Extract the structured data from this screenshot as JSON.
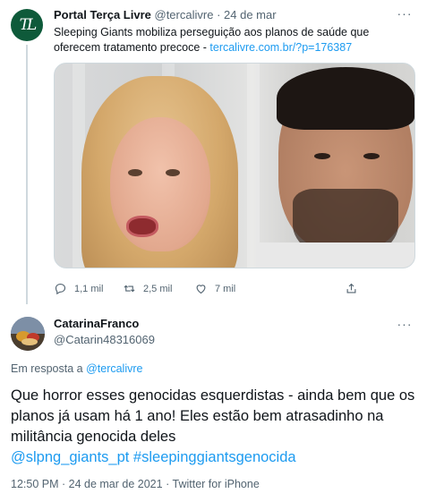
{
  "quoted_tweet": {
    "avatar_text": "TL",
    "author_name": "Portal Terça Livre",
    "author_handle": "@tercalivre",
    "separator": "·",
    "date": "24 de mar",
    "text": "Sleeping Giants mobiliza perseguição aos planos de saúde que oferecem tratamento precoce - ",
    "link": "tercalivre.com.br/?p=176387",
    "actions": {
      "reply_count": "1,1 mil",
      "retweet_count": "2,5 mil",
      "like_count": "7 mil"
    },
    "icons": [
      "reply-icon",
      "retweet-icon",
      "like-icon",
      "share-icon",
      "more-icon"
    ]
  },
  "main_tweet": {
    "author_name": "CatarinaFranco",
    "author_handle": "@Catarin48316069",
    "reply_prefix": "Em resposta a ",
    "reply_mention": "@tercalivre",
    "text": "Que horror esses genocidas esquerdistas - ainda bem que os planos já usam há 1 ano! Eles estão bem atrasadinho na militância genocida deles",
    "hashtags": "@slpng_giants_pt #sleepinggiantsgenocida",
    "time": "12:50 PM",
    "date": "24 de mar de 2021",
    "source": "Twitter for iPhone"
  },
  "colors": {
    "link": "#1d9bf0",
    "secondary_text": "#536471",
    "primary_text": "#0f1419",
    "avatar_green": "#0e5a3a"
  }
}
